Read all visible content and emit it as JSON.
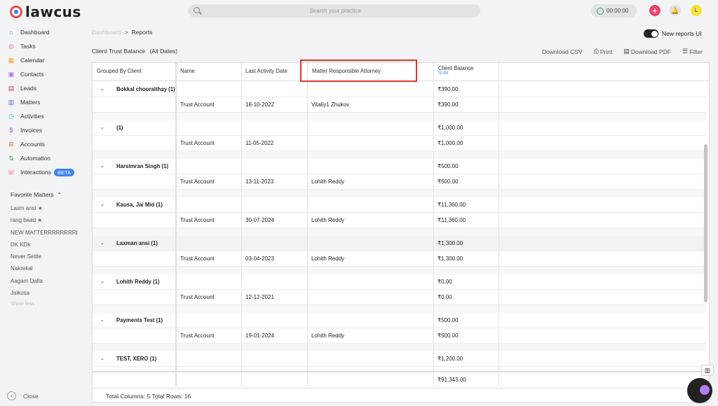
{
  "app": {
    "name": "lawcus"
  },
  "search": {
    "placeholder": "Search your practice"
  },
  "timer": {
    "value": "00:00:00"
  },
  "user": {
    "initial": "L"
  },
  "sidebar": {
    "items": [
      {
        "label": "Dashboard",
        "icon": "home-icon",
        "color": "#4a8ef0"
      },
      {
        "label": "Tasks",
        "icon": "tasks-icon",
        "color": "#e84dbb"
      },
      {
        "label": "Calendar",
        "icon": "calendar-icon",
        "color": "#f0a33b"
      },
      {
        "label": "Contacts",
        "icon": "contacts-icon",
        "color": "#b565e6"
      },
      {
        "label": "Leads",
        "icon": "leads-icon",
        "color": "#c0533a"
      },
      {
        "label": "Matters",
        "icon": "matters-icon",
        "color": "#4a77e8"
      },
      {
        "label": "Activities",
        "icon": "activities-icon",
        "color": "#36b7c9"
      },
      {
        "label": "Invoices",
        "icon": "invoices-icon",
        "color": "#9a5ce0"
      },
      {
        "label": "Accounts",
        "icon": "accounts-icon",
        "color": "#e0753a"
      },
      {
        "label": "Automation",
        "icon": "automation-icon",
        "color": "#3aa24a"
      },
      {
        "label": "Interactions",
        "icon": "interactions-icon",
        "color": "#e8436b",
        "badge": "BETA"
      }
    ],
    "favorites_title": "Favorite Matters",
    "favorites": [
      {
        "label": "Laxm ansi",
        "star": true
      },
      {
        "label": "rang baad",
        "star": true
      },
      {
        "label": "NEW MATTERRRRRRRRRR",
        "star": true
      },
      {
        "label": "DK KDk",
        "star": false
      },
      {
        "label": "Never Settle",
        "star": false
      },
      {
        "label": "Nakrekal",
        "star": false
      },
      {
        "label": "Aagam Dalla",
        "star": false
      },
      {
        "label": "Jaikusa",
        "star": false
      }
    ],
    "show_less": "Show less",
    "close": "Close"
  },
  "breadcrumb": {
    "parent": "Dashboard",
    "separator": ">",
    "current": "Reports"
  },
  "toggle": {
    "label": "New reports UI",
    "on": true
  },
  "report": {
    "title": "Client Trust Balance",
    "subtitle": "(All Dates)"
  },
  "actions": {
    "csv": "Download CSV",
    "print": "Print",
    "pdf": "Download PDF",
    "filter": "Filter"
  },
  "table": {
    "columns": [
      "Grouped By Client",
      "Name",
      "Last Activity Date",
      "Matter Responsible Attorney",
      "Client Balance"
    ],
    "sum_label": "SUM",
    "groups": [
      {
        "client": "Bokkal chooraithay (1)",
        "balance": "₹390.00",
        "highlight": false,
        "detail": {
          "name": "Trust Account",
          "date": "18-10-2022",
          "attorney": "Vitaliy1 Zhukov",
          "balance": "₹390.00"
        }
      },
      {
        "client": "(1)",
        "balance": "₹1,000.00",
        "highlight": false,
        "detail": {
          "name": "Trust Account",
          "date": "11-05-2022",
          "attorney": "",
          "balance": "₹1,000.00"
        }
      },
      {
        "client": "Harsimran Singh (1)",
        "balance": "₹500.00",
        "highlight": false,
        "detail": {
          "name": "Trust Account",
          "date": "13-11-2023",
          "attorney": "Lohith Reddy",
          "balance": "₹500.00"
        }
      },
      {
        "client": "Kausa, Jai Mid (1)",
        "balance": "₹11,360.00",
        "highlight": false,
        "detail": {
          "name": "Trust Account",
          "date": "30-07-2024",
          "attorney": "Lohith Reddy",
          "balance": "₹11,360.00"
        }
      },
      {
        "client": "Laxman ansi (1)",
        "balance": "₹1,300.00",
        "highlight": true,
        "detail": {
          "name": "Trust Account",
          "date": "03-04-2023",
          "attorney": "Lohith Reddy",
          "balance": "₹1,300.00"
        }
      },
      {
        "client": "Lohith Reddy (1)",
        "balance": "₹0.00",
        "highlight": false,
        "detail": {
          "name": "Trust Account",
          "date": "12-12-2021",
          "attorney": "",
          "balance": "₹0.00"
        }
      },
      {
        "client": "Payments Test (1)",
        "balance": "₹500.00",
        "highlight": false,
        "detail": {
          "name": "Trust Account",
          "date": "19-01-2024",
          "attorney": "Lohith Reddy",
          "balance": "₹500.00"
        }
      },
      {
        "client": "TEST, XERO (1)",
        "balance": "₹1,200.00",
        "highlight": false,
        "detail": null
      }
    ],
    "grand_total": "₹91,343.00",
    "footer": "Total Columns: 5  Total Rows: 16"
  }
}
